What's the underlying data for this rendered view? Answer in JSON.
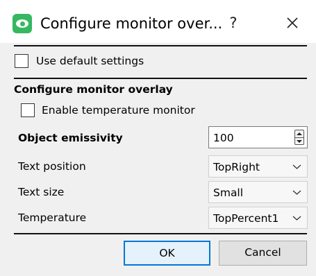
{
  "window": {
    "title": "Configure monitor over...",
    "help_label": "?",
    "close_icon": "close-icon",
    "app_icon": "eye-logo-icon"
  },
  "defaults": {
    "use_default_label": "Use default settings",
    "use_default_checked": false
  },
  "section": {
    "heading": "Configure monitor overlay",
    "enable_label": "Enable temperature monitor",
    "enable_checked": false
  },
  "fields": {
    "emissivity_label": "Object emissivity",
    "emissivity_value": "100",
    "text_position_label": "Text position",
    "text_position_value": "TopRight",
    "text_size_label": "Text size",
    "text_size_value": "Small",
    "temperature_label": "Temperature",
    "temperature_value": "TopPercent1"
  },
  "buttons": {
    "ok": "OK",
    "cancel": "Cancel"
  },
  "colors": {
    "accent": "#0078d7",
    "app_icon": "#35b860"
  }
}
